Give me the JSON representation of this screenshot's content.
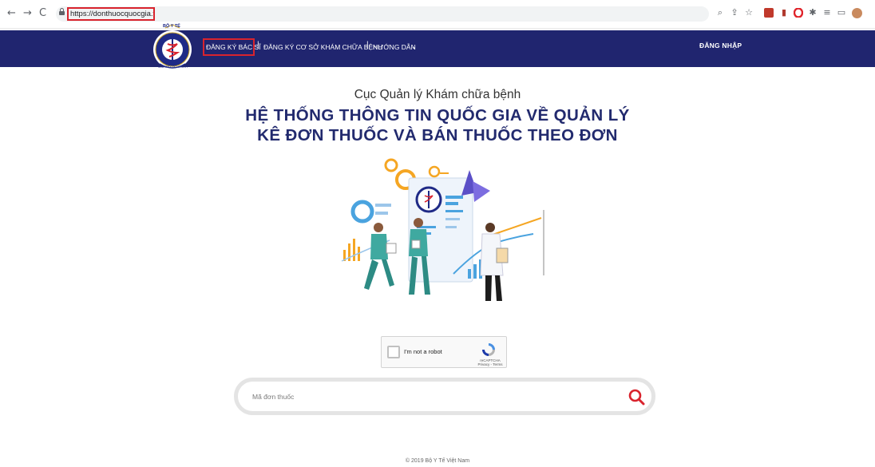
{
  "browser": {
    "back_glyph": "←",
    "forward_glyph": "→",
    "reload_glyph": "C",
    "url": "https://donthuocquocgia.vn",
    "toolbar_icons": [
      "zoom-icon",
      "share-icon",
      "star-icon",
      "extension-icon",
      "extension-icon",
      "opera-icon",
      "puzzle-icon",
      "reading-list-icon",
      "window-icon",
      "profile-avatar"
    ]
  },
  "header": {
    "logo_text_top": "BỘ Y TẾ",
    "logo_text_bottom": "MINISTRY OF HEALTH",
    "nav_items": [
      "ĐĂNG KÝ BÁC SĨ",
      "ĐĂNG KÝ CƠ SỞ KHÁM CHỮA BỆNH",
      "HƯỚNG DẪN"
    ],
    "separator": "|",
    "login_label": "ĐĂNG NHẬP"
  },
  "main": {
    "subtitle": "Cục Quản lý Khám chữa bệnh",
    "title_line_1": "HỆ THỐNG THÔNG TIN QUỐC GIA VỀ QUẢN LÝ",
    "title_line_2": "KÊ ĐƠN THUỐC VÀ BÁN THUỐC THEO ĐƠN"
  },
  "recaptcha": {
    "label": "I'm not a robot",
    "brand": "reCAPTCHA",
    "links": "Privacy - Terms"
  },
  "search": {
    "placeholder": "Mã đơn thuốc"
  },
  "footer": {
    "text": "© 2019 Bộ Y Tế Việt Nam"
  },
  "colors": {
    "header_bg": "#20256f",
    "title_color": "#222a6e",
    "highlight_red": "#d9232d",
    "search_icon": "#d9232d"
  }
}
